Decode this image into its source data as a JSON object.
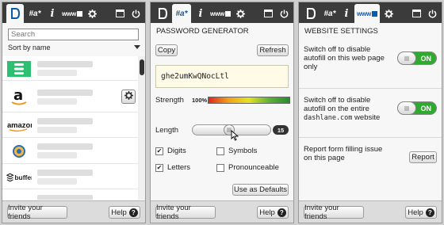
{
  "common": {
    "invite_label": "Invite your friends",
    "help_label": "Help",
    "help_icon": "?"
  },
  "tabs": {
    "passwords": "a",
    "pw_generator": "#a*",
    "info": "i",
    "website": "www"
  },
  "vault": {
    "search_placeholder": "Search",
    "sort_label": "Sort by name",
    "items": [
      {
        "logo": "database"
      },
      {
        "logo": "a"
      },
      {
        "logo": "amazon"
      },
      {
        "logo": "globe"
      },
      {
        "logo": "buffer"
      },
      {
        "logo": "red"
      }
    ]
  },
  "generator": {
    "title": "PASSWORD GENERATOR",
    "copy_label": "Copy",
    "refresh_label": "Refresh",
    "password": "ghe2umKwQNocLtl",
    "strength_label": "Strength",
    "strength_value": "100%",
    "length_label": "Length",
    "length_value": "15",
    "options": [
      {
        "label": "Digits",
        "checked": true
      },
      {
        "label": "Symbols",
        "checked": false
      },
      {
        "label": "Letters",
        "checked": true
      },
      {
        "label": "Pronounceable",
        "checked": false
      }
    ],
    "defaults_label": "Use as Defaults"
  },
  "website": {
    "title": "WEBSITE SETTINGS",
    "setting1_text": "Switch off to disable autofill on this web page only",
    "setting1_state": "ON",
    "setting2_text_a": "Switch off to disable autofill on the entire",
    "setting2_domain": "dashlane.com",
    "setting2_text_b": " website",
    "setting2_state": "ON",
    "report_text": "Report form filling issue on this page",
    "report_label": "Report"
  }
}
